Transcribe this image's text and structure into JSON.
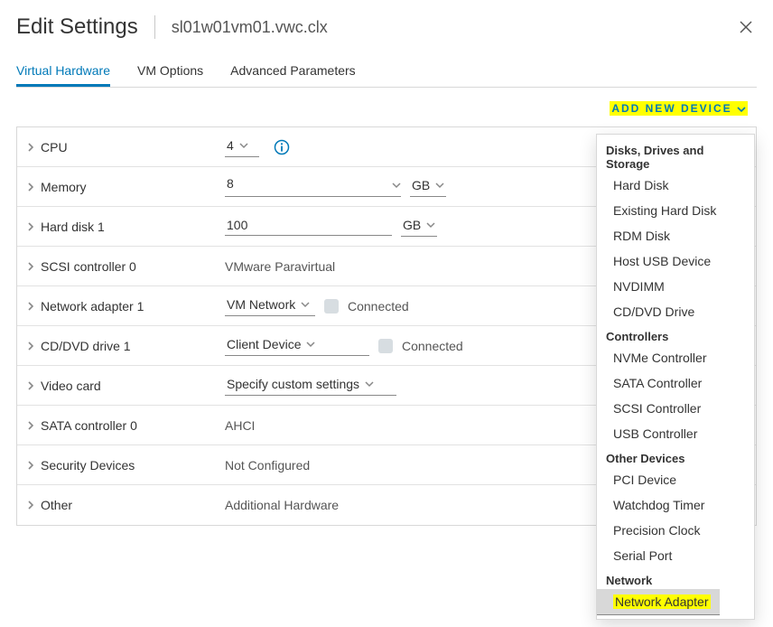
{
  "dialog": {
    "title": "Edit Settings",
    "object": "sl01w01vm01.vwc.clx"
  },
  "tabs": [
    {
      "id": "hw",
      "label": "Virtual Hardware",
      "active": true
    },
    {
      "id": "opt",
      "label": "VM Options",
      "active": false
    },
    {
      "id": "adv",
      "label": "Advanced Parameters",
      "active": false
    }
  ],
  "toolbar": {
    "add_label": "ADD NEW DEVICE"
  },
  "rows": {
    "cpu": {
      "label": "CPU",
      "value": "4"
    },
    "mem": {
      "label": "Memory",
      "value": "8",
      "unit": "GB"
    },
    "hd1": {
      "label": "Hard disk 1",
      "value": "100",
      "unit": "GB"
    },
    "scsi0": {
      "label": "SCSI controller 0",
      "value": "VMware Paravirtual"
    },
    "net1": {
      "label": "Network adapter 1",
      "value": "VM Network",
      "conn": "Connected"
    },
    "cddvd1": {
      "label": "CD/DVD drive 1",
      "value": "Client Device",
      "conn": "Connected"
    },
    "video": {
      "label": "Video card",
      "value": "Specify custom settings"
    },
    "sata0": {
      "label": "SATA controller 0",
      "value": "AHCI"
    },
    "sec": {
      "label": "Security Devices",
      "value": "Not Configured"
    },
    "other": {
      "label": "Other",
      "value": "Additional Hardware"
    }
  },
  "menu": {
    "c1": "Disks, Drives and Storage",
    "i1": "Hard Disk",
    "i2": "Existing Hard Disk",
    "i3": "RDM Disk",
    "i4": "Host USB Device",
    "i5": "NVDIMM",
    "i6": "CD/DVD Drive",
    "c2": "Controllers",
    "i7": "NVMe Controller",
    "i8": "SATA Controller",
    "i9": "SCSI Controller",
    "i10": "USB Controller",
    "c3": "Other Devices",
    "i11": "PCI Device",
    "i12": "Watchdog Timer",
    "i13": "Precision Clock",
    "i14": "Serial Port",
    "c4": "Network",
    "i15": "Network Adapter"
  }
}
